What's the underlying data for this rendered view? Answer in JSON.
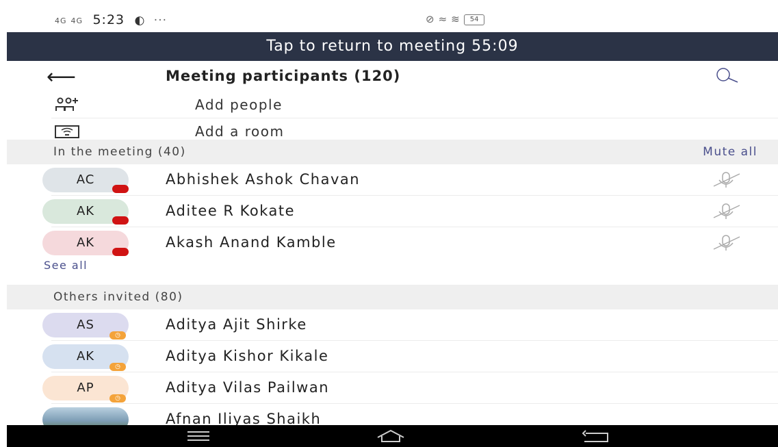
{
  "status_bar": {
    "network_left": "4G",
    "network_right": "4G",
    "time": "5:23",
    "dots": "···",
    "battery": "54"
  },
  "banner": {
    "text": "Tap to return to meeting 55:09"
  },
  "header": {
    "title": "Meeting participants (120)"
  },
  "actions": [
    {
      "label": "Add people",
      "icon": "add-people-icon"
    },
    {
      "label": "Add a room",
      "icon": "room-icon"
    }
  ],
  "in_meeting": {
    "label": "In the meeting (40)",
    "mute_all": "Mute all",
    "participants": [
      {
        "initials": "AC",
        "name": "Abhishek Ashok Chavan",
        "avatar_color": "#dfe4e8"
      },
      {
        "initials": "AK",
        "name": "Aditee R Kokate",
        "avatar_color": "#d9e8dc"
      },
      {
        "initials": "AK",
        "name": "Akash Anand Kamble",
        "avatar_color": "#f5d9dc"
      }
    ],
    "see_all": "See all"
  },
  "invited": {
    "label": "Others invited (80)",
    "people": [
      {
        "initials": "AS",
        "name": "Aditya Ajit Shirke",
        "avatar_color": "#dcdbef"
      },
      {
        "initials": "AK",
        "name": "Aditya Kishor Kikale",
        "avatar_color": "#d6e1f0"
      },
      {
        "initials": "AP",
        "name": "Aditya Vilas Pailwan",
        "avatar_color": "#fbe5d3"
      },
      {
        "initials": "",
        "name": "Afnan Iliyas Shaikh",
        "avatar_color": "#8fa7b8"
      }
    ]
  },
  "colors": {
    "banner": "#2b3346",
    "accent": "#4a4f8c",
    "presence_busy": "#d01313",
    "presence_away": "#f4a33a"
  }
}
